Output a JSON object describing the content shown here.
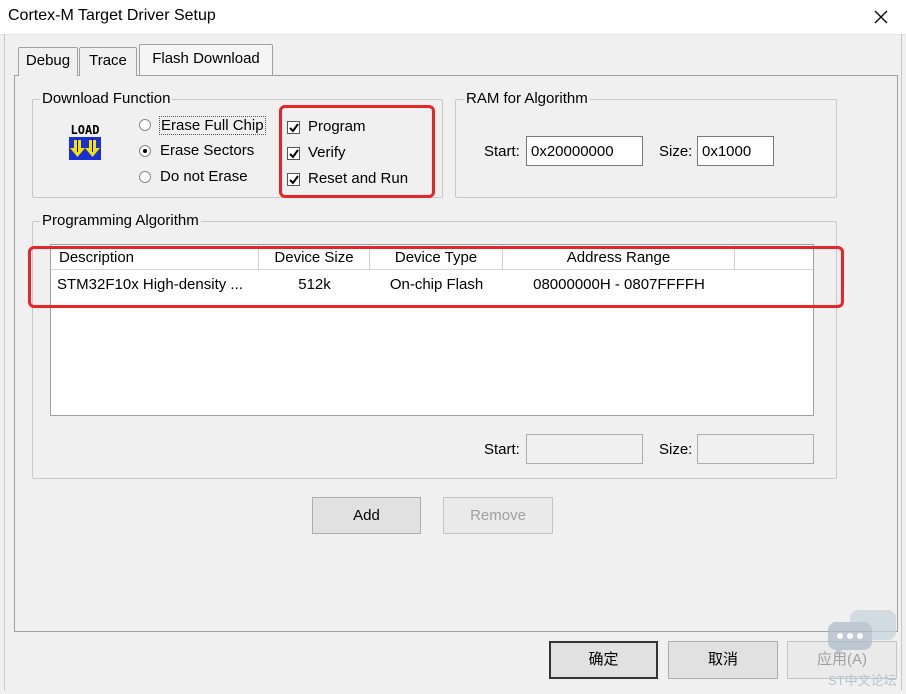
{
  "window": {
    "title": "Cortex-M Target Driver Setup"
  },
  "tabs": [
    {
      "label": "Debug"
    },
    {
      "label": "Trace"
    },
    {
      "label": "Flash Download"
    }
  ],
  "download_function": {
    "legend": "Download Function",
    "load_icon_text": "LOAD",
    "radios": [
      {
        "label": "Erase Full Chip",
        "checked": false
      },
      {
        "label": "Erase Sectors",
        "checked": true
      },
      {
        "label": "Do not Erase",
        "checked": false
      }
    ],
    "checkboxes": [
      {
        "label": "Program",
        "checked": true
      },
      {
        "label": "Verify",
        "checked": true
      },
      {
        "label": "Reset and Run",
        "checked": true
      }
    ]
  },
  "ram_for_algorithm": {
    "legend": "RAM for Algorithm",
    "start_label": "Start:",
    "start_value": "0x20000000",
    "size_label": "Size:",
    "size_value": "0x1000"
  },
  "programming_algorithm": {
    "legend": "Programming Algorithm",
    "columns": [
      "Description",
      "Device Size",
      "Device Type",
      "Address Range"
    ],
    "rows": [
      {
        "description": "STM32F10x High-density ...",
        "device_size": "512k",
        "device_type": "On-chip Flash",
        "address_range": "08000000H - 0807FFFFH"
      }
    ],
    "start_label": "Start:",
    "start_value": "",
    "size_label": "Size:",
    "size_value": ""
  },
  "buttons": {
    "add": "Add",
    "remove": "Remove"
  },
  "footer": {
    "ok": "确定",
    "cancel": "取消",
    "apply": "应用(A)"
  },
  "watermark": {
    "text": "ST中文论坛"
  },
  "colors": {
    "highlight_red": "#e8262a",
    "load_icon_blue": "#1a2fd6",
    "load_icon_yellow": "#f5e200"
  }
}
